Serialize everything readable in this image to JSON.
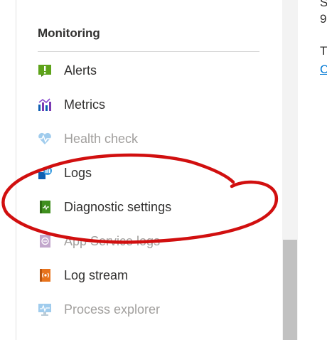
{
  "monitoring": {
    "title": "Monitoring",
    "items": [
      {
        "label": "Alerts",
        "icon": "alerts-icon",
        "enabled": true
      },
      {
        "label": "Metrics",
        "icon": "metrics-icon",
        "enabled": true
      },
      {
        "label": "Health check",
        "icon": "health-check-icon",
        "enabled": false
      },
      {
        "label": "Logs",
        "icon": "logs-icon",
        "enabled": true
      },
      {
        "label": "Diagnostic settings",
        "icon": "diagnostic-settings-icon",
        "enabled": true
      },
      {
        "label": "App Service logs",
        "icon": "app-service-logs-icon",
        "enabled": false
      },
      {
        "label": "Log stream",
        "icon": "log-stream-icon",
        "enabled": true
      },
      {
        "label": "Process explorer",
        "icon": "process-explorer-icon",
        "enabled": false
      }
    ]
  },
  "right_pane": {
    "line1": "S",
    "line2": "9",
    "line3": "T",
    "link": "C"
  },
  "colors": {
    "annotation": "#d10f0f",
    "link": "#0078d4"
  }
}
